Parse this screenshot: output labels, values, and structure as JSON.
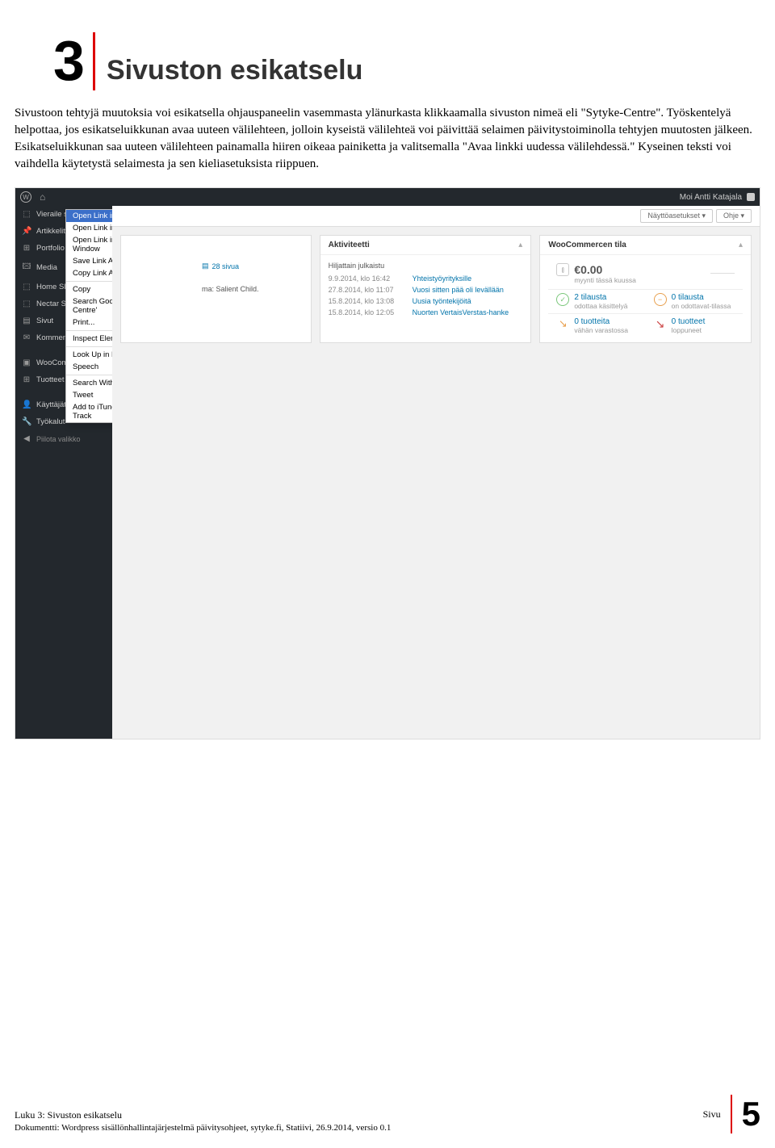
{
  "chapter": {
    "number": "3",
    "title": "Sivuston esikatselu"
  },
  "body": {
    "p1": "Sivustoon tehtyjä muutoksia voi esikatsella ohjauspaneelin vasemmasta ylänurkasta klikkaamalla sivuston nimeä eli \"Sytyke-Centre\". Työskentelyä helpottaa, jos esikatseluikkunan avaa uuteen välilehteen, jolloin kyseistä välilehteä voi päivittää selaimen päivitystoiminolla tehtyjen muutosten jälkeen. Esikatseluikkunan saa uuteen välilehteen painamalla hiiren oikeaa painiketta ja valitsemalla \"Avaa linkki uudessa välilehdessä.\" Kyseinen teksti voi vaihdella käytetystä selaimesta ja sen kieliasetuksista riippuen."
  },
  "wp": {
    "topbar": {
      "greeting": "Moi Antti Katajala"
    },
    "sidebar": [
      {
        "icon": "⬚",
        "label": "Vieraile siv",
        "active": false
      },
      {
        "icon": "📌",
        "label": "Artikkelit",
        "active": false
      },
      {
        "icon": "⊞",
        "label": "Portfolio",
        "active": false
      },
      {
        "icon": "🖾",
        "label": "Media",
        "active": false
      },
      {
        "icon": "⬚",
        "label": "Home Slide",
        "active": false
      },
      {
        "icon": "⬚",
        "label": "Nectar Slide",
        "active": false
      },
      {
        "icon": "▤",
        "label": "Sivut",
        "active": false
      },
      {
        "icon": "✉",
        "label": "Kommentit",
        "active": false
      },
      {
        "icon": "▣",
        "label": "WooCommerce",
        "active": false
      },
      {
        "icon": "⊞",
        "label": "Tuotteet",
        "active": false
      },
      {
        "icon": "👤",
        "label": "Käyttäjät",
        "active": false
      },
      {
        "icon": "🔧",
        "label": "Työkalut",
        "active": false
      },
      {
        "icon": "◀",
        "label": "Piilota valikko",
        "collapse": true
      }
    ],
    "context_menu": [
      {
        "label": "Open Link in New Tab",
        "highlight": true
      },
      {
        "label": "Open Link in New Window"
      },
      {
        "label": "Open Link in Incognito Window"
      },
      {
        "label": "Save Link As..."
      },
      {
        "label": "Copy Link Address"
      },
      {
        "sep": true
      },
      {
        "label": "Copy"
      },
      {
        "label": "Search Google for 'Sytyke-Centre'"
      },
      {
        "label": "Print..."
      },
      {
        "sep": true
      },
      {
        "label": "Inspect Element"
      },
      {
        "sep": true
      },
      {
        "label": "Look Up in Dictionary"
      },
      {
        "label": "Speech",
        "sub": true
      },
      {
        "sep": true
      },
      {
        "label": "Search With Google"
      },
      {
        "label": "Tweet"
      },
      {
        "label": "Add to iTunes as a Spoken Track"
      }
    ],
    "tabbar": {
      "left": "",
      "right1": "Näyttöasetukset ▾",
      "right2": "Ohje ▾"
    },
    "card1_pages": {
      "icon": "▤",
      "text": "28 sivua"
    },
    "card1_theme": "ma: Salient Child.",
    "card2": {
      "title": "Aktiviteetti",
      "sub": "Hiljattain julkaistu",
      "rows": [
        {
          "time": "9.9.2014, klo 16:42",
          "text": "Yhteistyöyrityksille"
        },
        {
          "time": "27.8.2014, klo 11:07",
          "text": "Vuosi sitten pää oli levällään"
        },
        {
          "time": "15.8.2014, klo 13:08",
          "text": "Uusia työntekijöitä"
        },
        {
          "time": "15.8.2014, klo 12:05",
          "text": "Nuorten VertaisVerstas-hanke"
        }
      ]
    },
    "card3": {
      "title": "WooCommercen tila",
      "sales": {
        "amount": "€0.00",
        "sub": "myynti tässä kuussa"
      },
      "orders1": {
        "count": "2 tilausta",
        "sub": "odottaa käsittelyä"
      },
      "orders2": {
        "count": "0 tilausta",
        "sub": "on odottavat-tilassa"
      },
      "stock1": {
        "count": "0 tuotteita",
        "sub": "vähän varastossa"
      },
      "stock2": {
        "count": "0 tuotteet",
        "sub": "loppuneet"
      }
    }
  },
  "footer": {
    "chapter": "Luku 3: Sivuston esikatselu",
    "doc": "Dokumentti: Wordpress sisällönhallintajärjestelmä päivitysohjeet, sytyke.fi, Statiivi, 26.9.2014, versio 0.1",
    "sivu": "Sivu",
    "page": "5"
  }
}
